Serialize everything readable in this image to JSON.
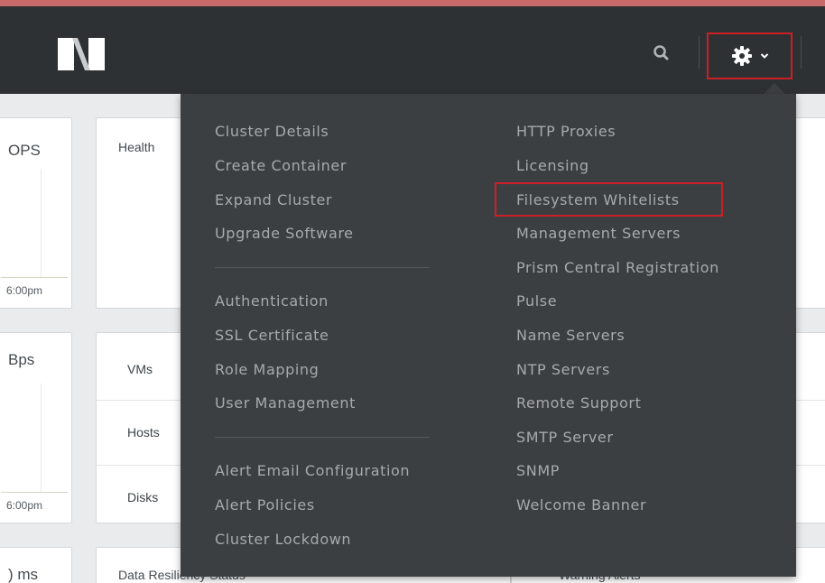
{
  "topbar": {
    "logo_icon": "nutanix-n-logo-icon",
    "search_icon": "search-icon",
    "settings_icon": "gear-icon",
    "chevron_icon": "chevron-down-icon",
    "accent_color": "#c96a6a"
  },
  "dashboard": {
    "iops_title": "OPS",
    "iops_tick": "6:00pm",
    "bandwidth_title": "Bps",
    "bandwidth_tick": "6:00pm",
    "latency_title": ") ms",
    "health_title": "Health",
    "vms_label": "VMs",
    "hosts_label": "Hosts",
    "disks_label": "Disks",
    "resiliency_title": "Data Resiliency Status",
    "warning_alerts_label": "Warning Alerts"
  },
  "settings_menu": {
    "left_group_1": [
      "Cluster Details",
      "Create Container",
      "Expand Cluster",
      "Upgrade Software"
    ],
    "left_group_2": [
      "Authentication",
      "SSL Certificate",
      "Role Mapping",
      "User Management"
    ],
    "left_group_3": [
      "Alert Email Configuration",
      "Alert Policies",
      "Cluster Lockdown"
    ],
    "right_items": [
      "HTTP Proxies",
      "Licensing",
      "Filesystem Whitelists",
      "Management Servers",
      "Prism Central Registration",
      "Pulse",
      "Name Servers",
      "NTP Servers",
      "Remote Support",
      "SMTP Server",
      "SNMP",
      "Welcome Banner"
    ],
    "highlighted_item": "Filesystem Whitelists",
    "highlight_color": "#cc1f25"
  }
}
